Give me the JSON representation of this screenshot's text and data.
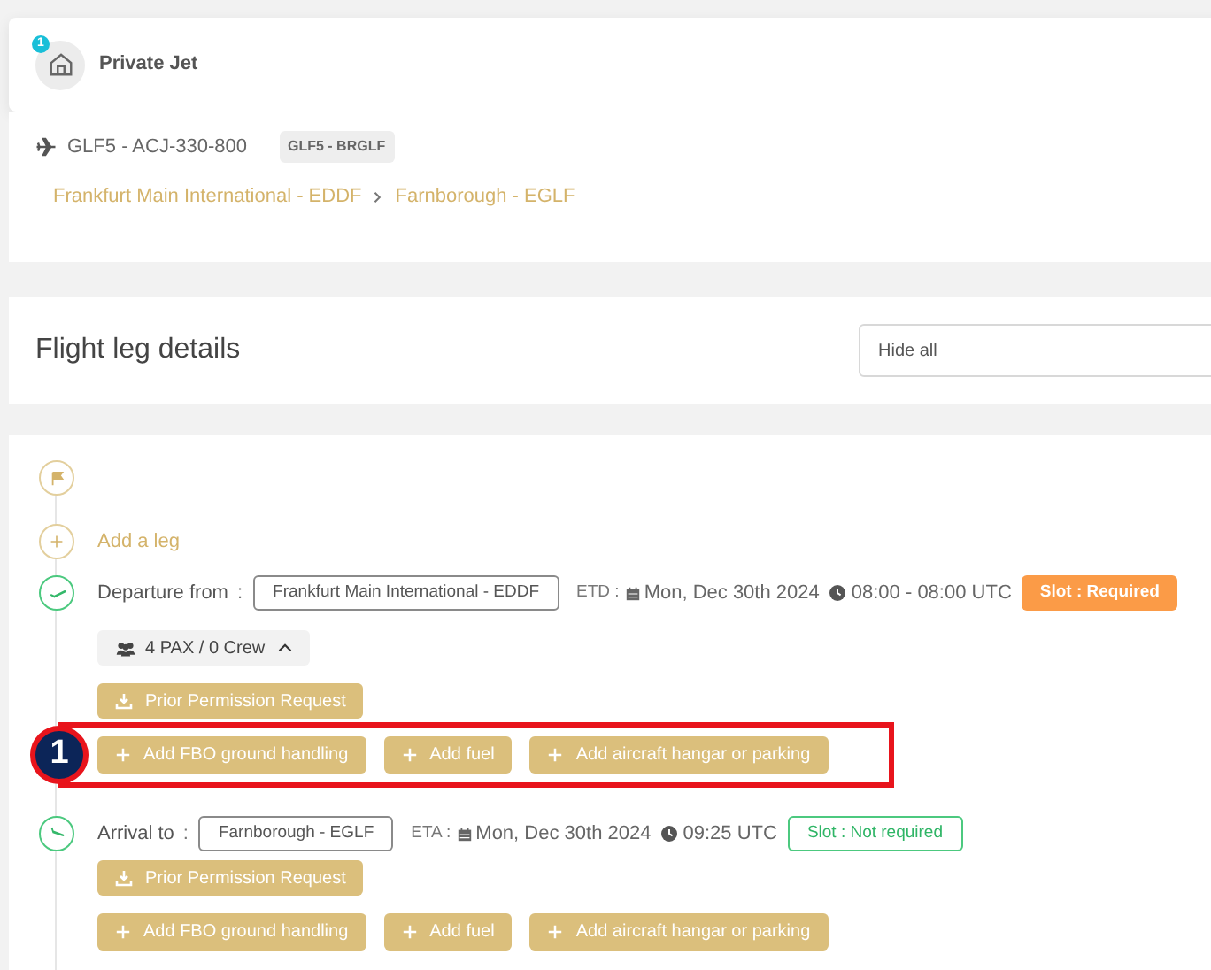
{
  "header": {
    "title": "Private Jet",
    "badge": "1"
  },
  "aircraft": {
    "name": "GLF5 - ACJ-330-800",
    "tag": "GLF5 - BRGLF"
  },
  "route": [
    "Frankfurt Main International - EDDF",
    "Farnborough - EGLF"
  ],
  "flight_leg_details": {
    "title": "Flight leg details",
    "select_value": "Hide all"
  },
  "add_leg": "Add a leg",
  "stops": [
    {
      "kind": "departure",
      "label": "Departure from",
      "separator": ":",
      "airport": "Frankfurt Main International - EDDF",
      "time_label": "ETD :",
      "date": "Mon, Dec 30th 2024",
      "time": "08:00 - 08:00 UTC",
      "slot": {
        "label": "Slot : Required",
        "required": true
      },
      "pax": {
        "label": "4 PAX / 0 Crew",
        "expanded": true
      },
      "ppr": "Prior Permission Request",
      "services": [
        "Add FBO ground handling",
        "Add fuel",
        "Add aircraft hangar or parking"
      ],
      "highlighted": true
    },
    {
      "kind": "arrival",
      "label": "Arrival to",
      "separator": ":",
      "airport": "Farnborough - EGLF",
      "time_label": "ETA :",
      "date": "Mon, Dec 30th 2024",
      "time": "09:25 UTC",
      "slot": {
        "label": "Slot : Not required",
        "required": false
      },
      "ppr": "Prior Permission Request",
      "services": [
        "Add FBO ground handling",
        "Add fuel",
        "Add aircraft hangar or parking"
      ],
      "highlighted": false
    }
  ],
  "annotation": {
    "number": "1"
  }
}
